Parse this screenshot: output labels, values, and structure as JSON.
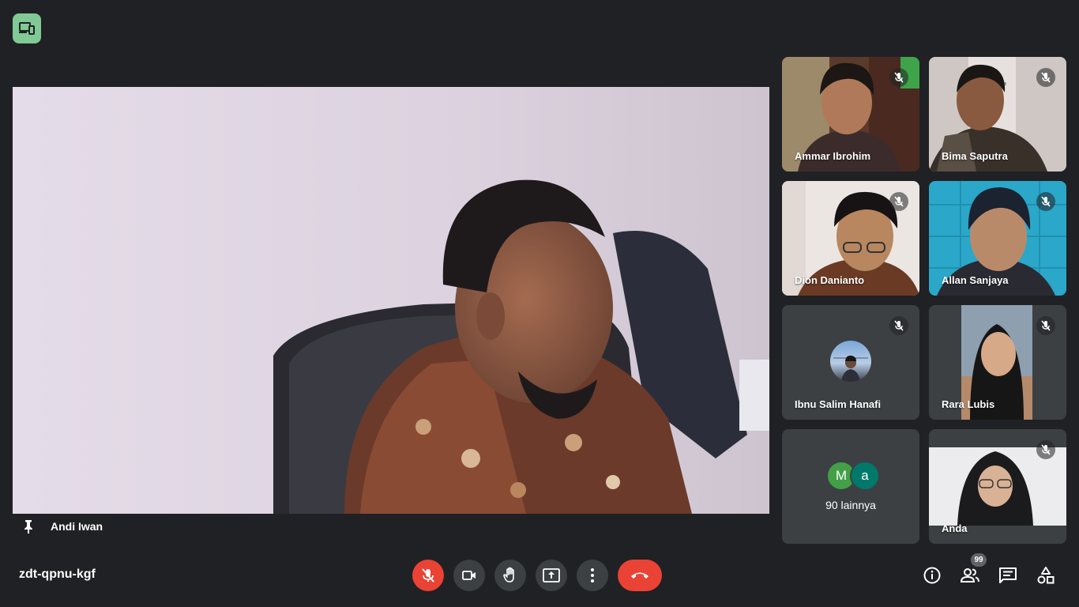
{
  "meeting": {
    "code": "zdt-qpnu-kgf"
  },
  "main_speaker": {
    "name": "Andi Iwan"
  },
  "participants": [
    {
      "name": "Ammar Ibrohim"
    },
    {
      "name": "Bima Saputra"
    },
    {
      "name": "Dion Danianto"
    },
    {
      "name": "Allan Sanjaya"
    },
    {
      "name": "Ibnu Salim Hanafi"
    },
    {
      "name": "Rara Lubis"
    },
    {
      "name": "Anda"
    }
  ],
  "more_participants": {
    "initial_1": "M",
    "initial_2": "a",
    "label": "90 lainnya"
  },
  "people_count": "99",
  "colors": {
    "background": "#202124",
    "tile": "#3c4043",
    "danger": "#ea4335",
    "badge_green": "#81c995",
    "avatar_m": "#43a047",
    "avatar_a": "#00796b"
  },
  "icons": {
    "top_badge": "devices-icon",
    "pin": "pin-icon",
    "mic_off": "mic-off-icon",
    "camera": "videocam-icon",
    "raise_hand": "hand-icon",
    "present": "present-screen-icon",
    "more": "more-vert-icon",
    "end_call": "call-end-icon",
    "info": "info-icon",
    "people": "people-icon",
    "chat": "chat-icon",
    "activities": "activities-icon"
  }
}
